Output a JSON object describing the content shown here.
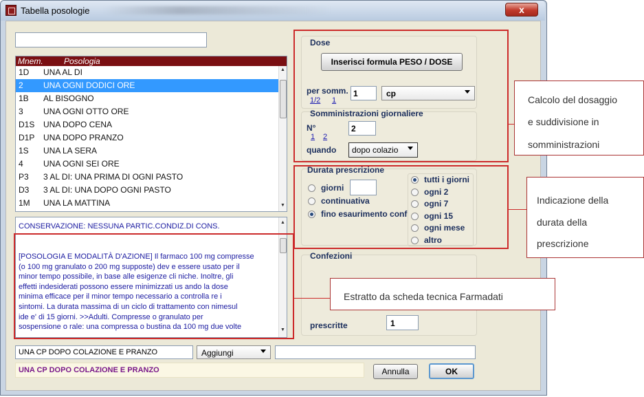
{
  "window": {
    "title": "Tabella posologie",
    "close_glyph": "x"
  },
  "search": {
    "value": ""
  },
  "list": {
    "headers": [
      "Mnem.",
      "Posologia"
    ],
    "selected_index": 1,
    "rows": [
      {
        "code": "1D",
        "text": "UNA AL DI"
      },
      {
        "code": "2",
        "text": "UNA OGNI DODICI ORE"
      },
      {
        "code": "1B",
        "text": "AL BISOGNO"
      },
      {
        "code": "3",
        "text": "UNA OGNI OTTO ORE"
      },
      {
        "code": "D1S",
        "text": "UNA DOPO CENA"
      },
      {
        "code": "D1P",
        "text": "UNA DOPO PRANZO"
      },
      {
        "code": "1S",
        "text": "UNA LA SERA"
      },
      {
        "code": "4",
        "text": "UNA OGNI SEI ORE"
      },
      {
        "code": "P3",
        "text": "3 AL DI: UNA PRIMA DI OGNI PASTO"
      },
      {
        "code": "D3",
        "text": "3 AL DI: UNA DOPO OGNI PASTO"
      },
      {
        "code": "1M",
        "text": "UNA LA MATTINA"
      }
    ]
  },
  "memo": {
    "conservation": "CONSERVAZIONE: NESSUNA PARTIC.CONDIZ.DI CONS.",
    "lines": [
      "[POSOLOGIA E MODALITÀ D'AZIONE]  Il farmaco 100 mg compresse",
      "(o 100 mg granulato o 200 mg supposte) dev e essere usato per il",
      "minor tempo possibile, in base alle esigenze cli niche. Inoltre, gli",
      "effetti indesiderati possono essere minimizzati us ando la dose",
      "minima efficace per il minor tempo necessario a controlla re i",
      "sintomi. La durata massima di un ciclo di trattamento con nimesul",
      "ide e' di 15 giorni. >>Adulti. Compresse o granulato per",
      "sospensione o rale: una compressa o bustina da 100 mg due volte"
    ]
  },
  "bottom": {
    "summary_field": "UNA CP DOPO COLAZIONE E PRANZO",
    "add_combo": "Aggiungi",
    "extra_field": "",
    "result_text": "UNA CP DOPO COLAZIONE E PRANZO",
    "cancel_label": "Annulla",
    "ok_label": "OK"
  },
  "dose": {
    "title": "Dose",
    "formula_button": "Inserisci formula PESO / DOSE",
    "per_somm_label": "per somm.",
    "frac_half": "1/2",
    "frac_one": "1",
    "qty_value": "1",
    "unit": "cp"
  },
  "daily": {
    "title": "Somministrazioni giornaliere",
    "n_label": "N°",
    "opt_1": "1",
    "opt_2": "2",
    "n_value": "2",
    "when_label": "quando",
    "when_value": "dopo colazio"
  },
  "duration": {
    "title": "Durata prescrizione",
    "left_options": [
      "giorni",
      "continuativa",
      "fino esaurimento conf"
    ],
    "left_selected": 2,
    "days_value": "",
    "right_options": [
      "tutti i giorni",
      "ogni 2",
      "ogni 7",
      "ogni 15",
      "ogni mese",
      "altro"
    ],
    "right_selected": 0
  },
  "packages": {
    "title": "Confezioni",
    "prescribed_label": "prescritte",
    "prescribed_value": "1"
  },
  "callouts": {
    "dosage": [
      "Calcolo del dosaggio",
      "e suddivisione in",
      "somministrazioni"
    ],
    "duration": [
      "Indicazione della",
      "durata della",
      "prescrizione"
    ],
    "extract": "Estratto da scheda tecnica Farmadati"
  },
  "colors": {
    "accent_red": "#cc2a2a",
    "list_header": "#7a0f12",
    "selection": "#3399ff"
  }
}
